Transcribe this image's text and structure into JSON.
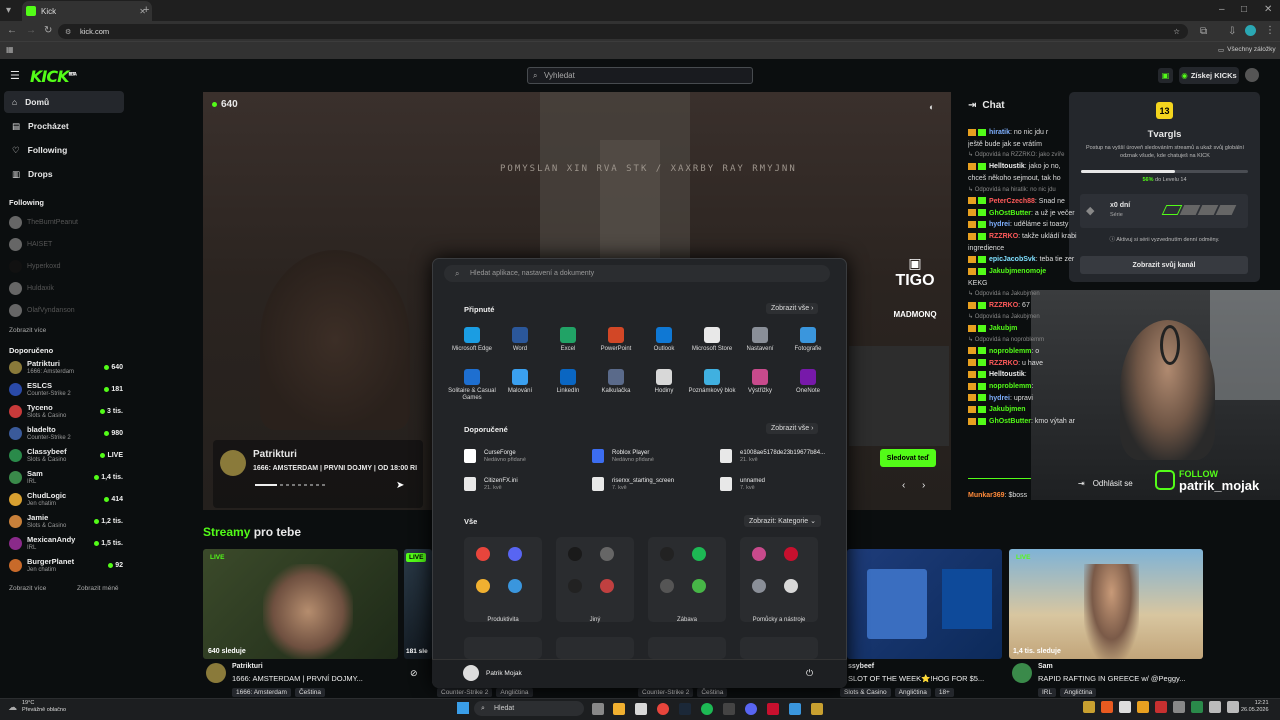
{
  "browser": {
    "tab_title": "Kick",
    "url": "kick.com",
    "bookmarks_label": "Všechny záložky"
  },
  "header": {
    "logo": "KICK",
    "logo_tag": "BETA",
    "search_placeholder": "Vyhledat",
    "kicks_button": "Získej KICKs"
  },
  "sidebar": {
    "nav": [
      {
        "label": "Domů"
      },
      {
        "label": "Procházet"
      },
      {
        "label": "Following"
      },
      {
        "label": "Drops"
      }
    ],
    "following_title": "Following",
    "following": [
      {
        "name": "TheBurntPeanut"
      },
      {
        "name": "HAISET"
      },
      {
        "name": "Hyperkoxd"
      },
      {
        "name": "Huldaxik"
      },
      {
        "name": "OlafVyndanson"
      }
    ],
    "following_more": "Zobrazit více",
    "recommended_title": "Doporučeno",
    "recommended": [
      {
        "name": "Patrikturi",
        "category": "1666: Amsterdam",
        "viewers": "640"
      },
      {
        "name": "ESLCS",
        "category": "Counter-Strike 2",
        "viewers": "181"
      },
      {
        "name": "Tyceno",
        "category": "Slots & Casino",
        "viewers": "3 tis."
      },
      {
        "name": "bladelto",
        "category": "Counter-Strike 2",
        "viewers": "980"
      },
      {
        "name": "Classybeef",
        "category": "Slots & Casino",
        "viewers": "LIVE"
      },
      {
        "name": "Sam",
        "category": "IRL",
        "viewers": "1,4 tis."
      },
      {
        "name": "ChudLogic",
        "category": "Jen chatim",
        "viewers": "414"
      },
      {
        "name": "Jamie",
        "category": "Slots & Casino",
        "viewers": "1,2 tis."
      },
      {
        "name": "MexicanAndy",
        "category": "IRL",
        "viewers": "1,5 tis."
      },
      {
        "name": "BurgerPlanet",
        "category": "Jen chatim",
        "viewers": "92"
      }
    ],
    "rec_more": "Zobrazit více",
    "rec_less": "Zobrazit méně"
  },
  "video": {
    "viewers": "640",
    "ghost_text": "POMYSLAN XIN RVA STK / XAXRBY RAY RMYJNN",
    "streamer": "Patrikturi",
    "stream_title": "1666: AMSTERDAM | PRVNÍ DOJMY | OD 18:00 RI",
    "follow_button": "Sledovat teď",
    "sponsor1": "TIGO",
    "sponsor2": "MADMONQ"
  },
  "start_menu": {
    "search_placeholder": "Hledat aplikace, nastavení a dokumenty",
    "pinned_title": "Připnuté",
    "pinned_more": "Zobrazit vše",
    "pinned": [
      {
        "label": "Microsoft Edge",
        "color": "#1b9de2"
      },
      {
        "label": "Word",
        "color": "#2b579a"
      },
      {
        "label": "Excel",
        "color": "#21a366"
      },
      {
        "label": "PowerPoint",
        "color": "#d24726"
      },
      {
        "label": "Outlook",
        "color": "#0f78d4"
      },
      {
        "label": "Microsoft Store",
        "color": "#e8e8e8"
      },
      {
        "label": "Nastavení",
        "color": "#8a8f98"
      },
      {
        "label": "Fotografie",
        "color": "#3a96dd"
      },
      {
        "label": "Solitaire & Casual Games",
        "color": "#1e6fd0"
      },
      {
        "label": "Malování",
        "color": "#3aa0f0"
      },
      {
        "label": "LinkedIn",
        "color": "#0a66c2"
      },
      {
        "label": "Kalkulačka",
        "color": "#5a6a8a"
      },
      {
        "label": "Hodiny",
        "color": "#d8d8d8"
      },
      {
        "label": "Poznámkový blok",
        "color": "#40b0e0"
      },
      {
        "label": "Výstřižky",
        "color": "#c84a8c"
      },
      {
        "label": "OneNote",
        "color": "#7719aa"
      }
    ],
    "recommended_title": "Doporučené",
    "recommended_more": "Zobrazit vše",
    "recommended": [
      {
        "name": "CurseForge",
        "detail": "Nedávno přidané",
        "color": "#ffffff"
      },
      {
        "name": "Roblox Player",
        "detail": "Nedávno přidané",
        "color": "#3c6df0"
      },
      {
        "name": "e1008ae5178de23b19677b84...",
        "detail": "21. kvě",
        "color": "#e8e8e8"
      },
      {
        "name": "CitizenFX.ini",
        "detail": "21. kvě",
        "color": "#e8e8e8"
      },
      {
        "name": "riserxx_starting_screen",
        "detail": "7. kvě",
        "color": "#e8e8e8"
      },
      {
        "name": "unnamed",
        "detail": "7. kvě",
        "color": "#e8e8e8"
      }
    ],
    "all_title": "Vše",
    "all_view": "Zobrazit: Kategorie",
    "groups": [
      {
        "label": "Produktivita",
        "icons": [
          "#e8453c",
          "#5865f2",
          "#f0b030",
          "#3a96dd"
        ]
      },
      {
        "label": "Jiný",
        "icons": [
          "#1a1a1a",
          "#666666",
          "#222222",
          "#c04040"
        ]
      },
      {
        "label": "Zábava",
        "icons": [
          "#222222",
          "#1db954",
          "#555555",
          "#47b647"
        ]
      },
      {
        "label": "Pomůcky a nástroje",
        "icons": [
          "#c84a8c",
          "#c8102e",
          "#8a8f98",
          "#d8d8d8"
        ]
      }
    ],
    "user_name": "Patrik Mojak"
  },
  "streams": {
    "title_accent": "Streamy",
    "title_rest": "pro tebe",
    "live_label": "LIVE",
    "items": [
      {
        "viewers": "640 sleduje",
        "name": "Patrikturi",
        "title": "1666: AMSTERDAM | PRVNÍ DOJMY...",
        "tags": [
          "1666: Amsterdam",
          "Čeština"
        ]
      },
      {
        "viewers": "181 sle",
        "name": "",
        "title": "",
        "tags": [
          "Counter-Strike 2",
          "Angličtina"
        ]
      },
      {
        "viewers": "",
        "name": "",
        "title": "",
        "tags": [
          "Counter-Strike 2",
          "Čeština"
        ]
      },
      {
        "viewers": "",
        "name": "ssybeef",
        "title": "SLOT OF THE WEEK⭐!HOG FOR $5...",
        "tags": [
          "Slots & Casino",
          "Angličtina",
          "18+"
        ]
      },
      {
        "viewers": "1,4 tis. sleduje",
        "name": "Sam",
        "title": "RAPID RAFTING IN GREECE w/ @Peggy...",
        "tags": [
          "IRL",
          "Angličtina"
        ]
      }
    ]
  },
  "chat": {
    "title": "Chat",
    "messages": [
      {
        "type": "msg",
        "user": "hiratik",
        "text": ": no nic jdu r",
        "color": "#7fb0ff"
      },
      {
        "type": "cont",
        "text": "ještě bude jak se vrátím"
      },
      {
        "type": "reply",
        "text": "Odpovídá na RZZRKO: jako zvíře"
      },
      {
        "type": "msg",
        "user": "Helltoustik",
        "text": ": jako jo no,",
        "color": "#eeeeee"
      },
      {
        "type": "cont",
        "text": "chceš někoho sejmout, tak ho"
      },
      {
        "type": "reply",
        "text": "Odpovídá na hiratik: no nic jdu"
      },
      {
        "type": "msg",
        "user": "PeterCzech88",
        "text": ": Snad ne",
        "color": "#ff5a5a"
      },
      {
        "type": "msg",
        "user": "GhOstButter",
        "text": ": a už je večer",
        "color": "#53fc18"
      },
      {
        "type": "msg",
        "user": "hydrei",
        "text": ": uděláme si toasty",
        "color": "#7fb0ff"
      },
      {
        "type": "msg",
        "user": "RZZRKO",
        "text": ": takže ukládí krabi",
        "color": "#ff5a5a"
      },
      {
        "type": "cont",
        "text": "ingredience"
      },
      {
        "type": "msg",
        "user": "epicJacobSvk",
        "text": ": teba tie zer",
        "color": "#7fe0ff"
      },
      {
        "type": "msg",
        "user": "Jakubjmenomoje",
        "text": "",
        "color": "#53fc18"
      },
      {
        "type": "cont",
        "text": "KEKG"
      },
      {
        "type": "reply",
        "text": "Odpovídá na Jakubjmen"
      },
      {
        "type": "msg",
        "user": "RZZRKO",
        "text": ": 67",
        "color": "#ff5a5a"
      },
      {
        "type": "reply",
        "text": "Odpovídá na Jakubjmen"
      },
      {
        "type": "msg",
        "user": "Jakubjm",
        "text": "",
        "color": "#53fc18"
      },
      {
        "type": "reply",
        "text": "Odpovídá na noproblemm"
      },
      {
        "type": "msg",
        "user": "noproblemm",
        "text": ": o",
        "color": "#53fc18"
      },
      {
        "type": "msg",
        "user": "RZZRKO",
        "text": ": u have",
        "color": "#ff5a5a"
      },
      {
        "type": "msg",
        "user": "Helltoustik",
        "text": ":",
        "color": "#eeeeee"
      },
      {
        "type": "msg",
        "user": "noproblemm",
        "text": ":",
        "color": "#53fc18"
      },
      {
        "type": "msg",
        "user": "hydrei",
        "text": ": upravi",
        "color": "#7fb0ff"
      },
      {
        "type": "msg",
        "user": "Jakubjmen",
        "text": "",
        "color": "#53fc18"
      },
      {
        "type": "msg",
        "user": "GhOstButter",
        "text": ": kmo výtah ar",
        "color": "#53fc18"
      }
    ],
    "bottom_user": "Munkar369",
    "bottom_text": ": $boss"
  },
  "kicks_popup": {
    "level": "13",
    "name": "Tvargls",
    "description": "Postup na vyšší úroveň sledováním streamů a ukaž svůj globální odznak všude, kde chatuješ na KICK",
    "progress_text": "56%",
    "progress_suffix": "do Levelu 14",
    "progress": 0.56,
    "streak_days": "x0 dní",
    "streak_label": "Série",
    "streak_note": "Aktivuj si sérii vyzvednutím denní odměny.",
    "claim_button": "Zobrazit svůj kanál"
  },
  "account_menu": {
    "logout": "Odhlásit se"
  },
  "webcam": {
    "follow_word": "FOLLOW",
    "handle": "patrik_mojak"
  },
  "taskbar": {
    "weather_temp": "19°C",
    "weather_text": "Převážně oblačno",
    "search": "Hledat",
    "time": "12:21",
    "date": "26.05.2026"
  }
}
